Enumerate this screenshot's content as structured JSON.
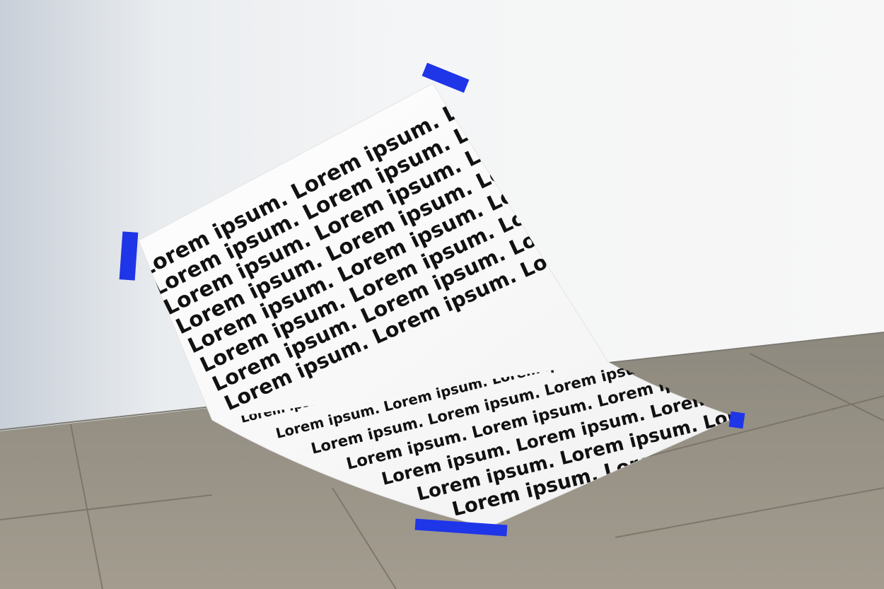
{
  "poster": {
    "phrase": "Lorem ipsum.",
    "upper_rows": 8,
    "lower_rows": 7,
    "phrases_per_row": 3
  },
  "colors": {
    "tape": "#1f35e8",
    "paper": "#fafafa",
    "ink": "#111111",
    "wall": "#f4f5f6",
    "floor": "#9a9285"
  }
}
